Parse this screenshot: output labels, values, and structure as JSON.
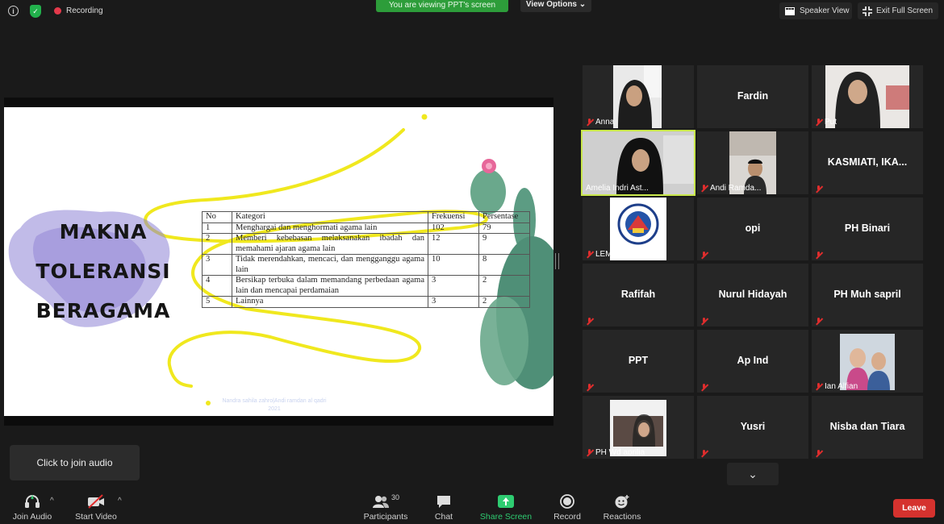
{
  "top_bar": {
    "recording_label": "Recording",
    "viewing_banner": "You are viewing PPT's screen",
    "view_options": "View Options",
    "speaker_view": "Speaker View",
    "exit_full_screen": "Exit Full Screen"
  },
  "slide": {
    "title_lines": [
      "MAKNA",
      "TOLERANSI",
      "BERAGAMA"
    ],
    "table": {
      "headers": [
        "No",
        "Kategori",
        "Frekuensi",
        "Persentase"
      ],
      "rows": [
        [
          "1",
          "Menghargai dan menghormati agama lain",
          "102",
          "79"
        ],
        [
          "2",
          "Memberi kebebasan melaksanakan ibadah dan memahami ajaran agama lain",
          "12",
          "9"
        ],
        [
          "3",
          "Tidak merendahkan, mencaci, dan mengganggu agama lain",
          "10",
          "8"
        ],
        [
          "4",
          "Bersikap terbuka dalam memandang perbedaan agama lain dan mencapai perdamaian",
          "3",
          "2"
        ],
        [
          "5",
          "Lainnya",
          "3",
          "2"
        ]
      ]
    },
    "credit_line1": "Nandra sahila zahro|Andi ramdan al qadri",
    "credit_line2": "2021"
  },
  "participants_grid": [
    {
      "name": "Anna",
      "video": true
    },
    {
      "name": "Fardin",
      "video": false
    },
    {
      "name": "Put",
      "video": true
    },
    {
      "name": "Amelia Indri Ast...",
      "video": true,
      "active_speaker": true
    },
    {
      "name": "Andi Ramda...",
      "video": true
    },
    {
      "name": "KASMIATI, IKA...",
      "video": false
    },
    {
      "name": "LEMBAGA RE...",
      "video": true
    },
    {
      "name": "opi",
      "video": false
    },
    {
      "name": "PH Binari",
      "video": false
    },
    {
      "name": "Rafifah",
      "video": false
    },
    {
      "name": "Nurul Hidayah",
      "video": false
    },
    {
      "name": "PH Muh sapril",
      "video": false
    },
    {
      "name": "PPT",
      "video": false
    },
    {
      "name": "Ap Ind",
      "video": false
    },
    {
      "name": "Ian Alfian",
      "video": true
    },
    {
      "name": "PH Wd aprilia",
      "video": true
    },
    {
      "name": "Yusri",
      "video": false
    },
    {
      "name": "Nisba dan Tiara",
      "video": false
    }
  ],
  "tooltip": "Click to join audio",
  "toolbar": {
    "join_audio": "Join Audio",
    "start_video": "Start Video",
    "participants": "Participants",
    "participants_count": "30",
    "chat": "Chat",
    "share_screen": "Share Screen",
    "record": "Record",
    "reactions": "Reactions",
    "leave": "Leave"
  },
  "colors": {
    "background": "#1a1a1a",
    "tile": "#262626",
    "banner_green": "#2d9d3a",
    "share_green": "#2ecc71",
    "leave_red": "#d5322e",
    "speaker_border": "#c8e64b",
    "muted_red": "#e02d2d"
  }
}
